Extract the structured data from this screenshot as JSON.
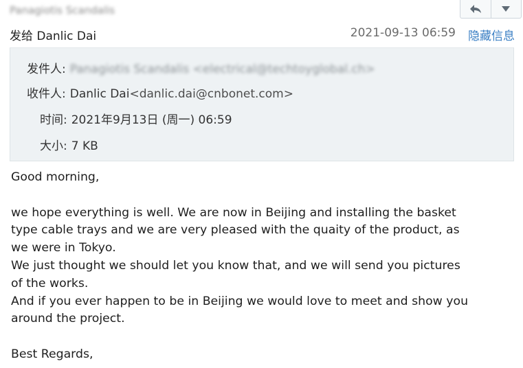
{
  "header": {
    "sender_display": "Panagiotis Scandalis",
    "reply_icon": "reply-arrow-icon",
    "more_icon": "caret-down-icon",
    "to_line": "发给 Danlic Dai",
    "date": "2021-09-13 06:59",
    "hide_link": "隐藏信息"
  },
  "details": {
    "from_label": "发件人:",
    "from_value": "Panagiotis Scandalis <electrical@techtoyglobal.ch>",
    "to_label": "收件人:",
    "to_name": "Danlic Dai",
    "to_email": "<danlic.dai@cnbonet.com>",
    "time_label": "时间:",
    "time_value": "2021年9月13日 (周一) 06:59",
    "size_label": "大小:",
    "size_value": "7 KB"
  },
  "body": {
    "greeting": "Good morning,",
    "line1": "we hope everything is well. We are now in Beijing and installing the basket",
    "line2": "type cable trays and we are very pleased with the quaity of the product, as",
    "line3": "we were in Tokyo.",
    "line4": "We just thought we should let you know that, and we will send you pictures",
    "line5": "of the works.",
    "line6": "And if you ever happen to be in Beijing we would love to meet and show you",
    "line7": "around the project.",
    "closing": "Best Regards,"
  },
  "colors": {
    "link": "#3a7fc4",
    "details_background": "#eef2f4",
    "date_text": "#6b6b6b"
  }
}
